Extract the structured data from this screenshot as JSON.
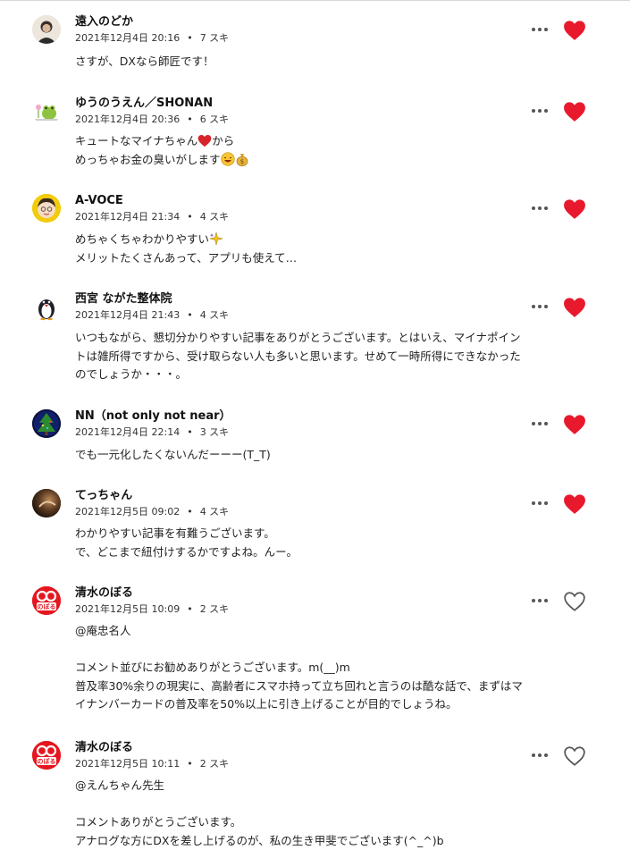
{
  "colors": {
    "heart_active": "#e8192c",
    "text": "#222222",
    "meta": "#333333"
  },
  "comments": [
    {
      "name": "遠入のどか",
      "date": "2021年12月4日 20:16",
      "likes": "7 スキ",
      "liked": true,
      "avatar": "portrait-avatar",
      "lines": [
        "さすが、DXなら師匠です！"
      ]
    },
    {
      "name": "ゆうのうえん／SHONAN",
      "date": "2021年12月4日 20:36",
      "likes": "6 スキ",
      "liked": true,
      "avatar": "frog-avatar",
      "lines": [
        "キュートなマイナちゃん",
        "から",
        "めっちゃお金の臭いがします"
      ]
    },
    {
      "name": "A-VOCE",
      "date": "2021年12月4日 21:34",
      "likes": "4 スキ",
      "liked": true,
      "avatar": "cartoon-face-avatar",
      "lines": [
        "めちゃくちゃわかりやすい",
        "メリットたくさんあって、アプリも使えて…"
      ]
    },
    {
      "name": "西宮 ながた整体院",
      "date": "2021年12月4日 21:43",
      "likes": "4 スキ",
      "liked": true,
      "avatar": "penguin-avatar",
      "lines": [
        "いつもながら、懇切分かりやすい記事をありがとうございます。とはいえ、マイナポイン",
        "トは雑所得ですから、受け取らない人も多いと思います。せめて一時所得にできなかった",
        "のでしょうか・・・。"
      ]
    },
    {
      "name": "NN（not only not near）",
      "date": "2021年12月4日 22:14",
      "likes": "3 スキ",
      "liked": true,
      "avatar": "tree-avatar",
      "lines": [
        "でも一元化したくないんだーーー(T_T)"
      ]
    },
    {
      "name": "てっちゃん",
      "date": "2021年12月5日 09:02",
      "likes": "4 スキ",
      "liked": true,
      "avatar": "dark-photo-avatar",
      "lines": [
        "わかりやすい記事を有難うございます。",
        "で、どこまで紐付けするかですよね。んー。"
      ]
    },
    {
      "name": "清水のぼる",
      "date": "2021年12月5日 10:09",
      "likes": "2 スキ",
      "liked": false,
      "avatar": "noboru-logo-avatar",
      "lines": [
        "@庵忠名人",
        "",
        "コメント並びにお勧めありがとうございます。m(__)m",
        "普及率30%余りの現実に、高齢者にスマホ持って立ち回れと言うのは酷な話で、まずはマ",
        "イナンバーカードの普及率を50%以上に引き上げることが目的でしょうね。"
      ]
    },
    {
      "name": "清水のぼる",
      "date": "2021年12月5日 10:11",
      "likes": "2 スキ",
      "liked": false,
      "avatar": "noboru-logo-avatar",
      "lines": [
        "@えんちゃん先生",
        "",
        "コメントありがとうございます。",
        "アナログな方にDXを差し上げるのが、私の生き甲斐でございます(^_^)b"
      ]
    }
  ],
  "logo_text": "のぼる"
}
